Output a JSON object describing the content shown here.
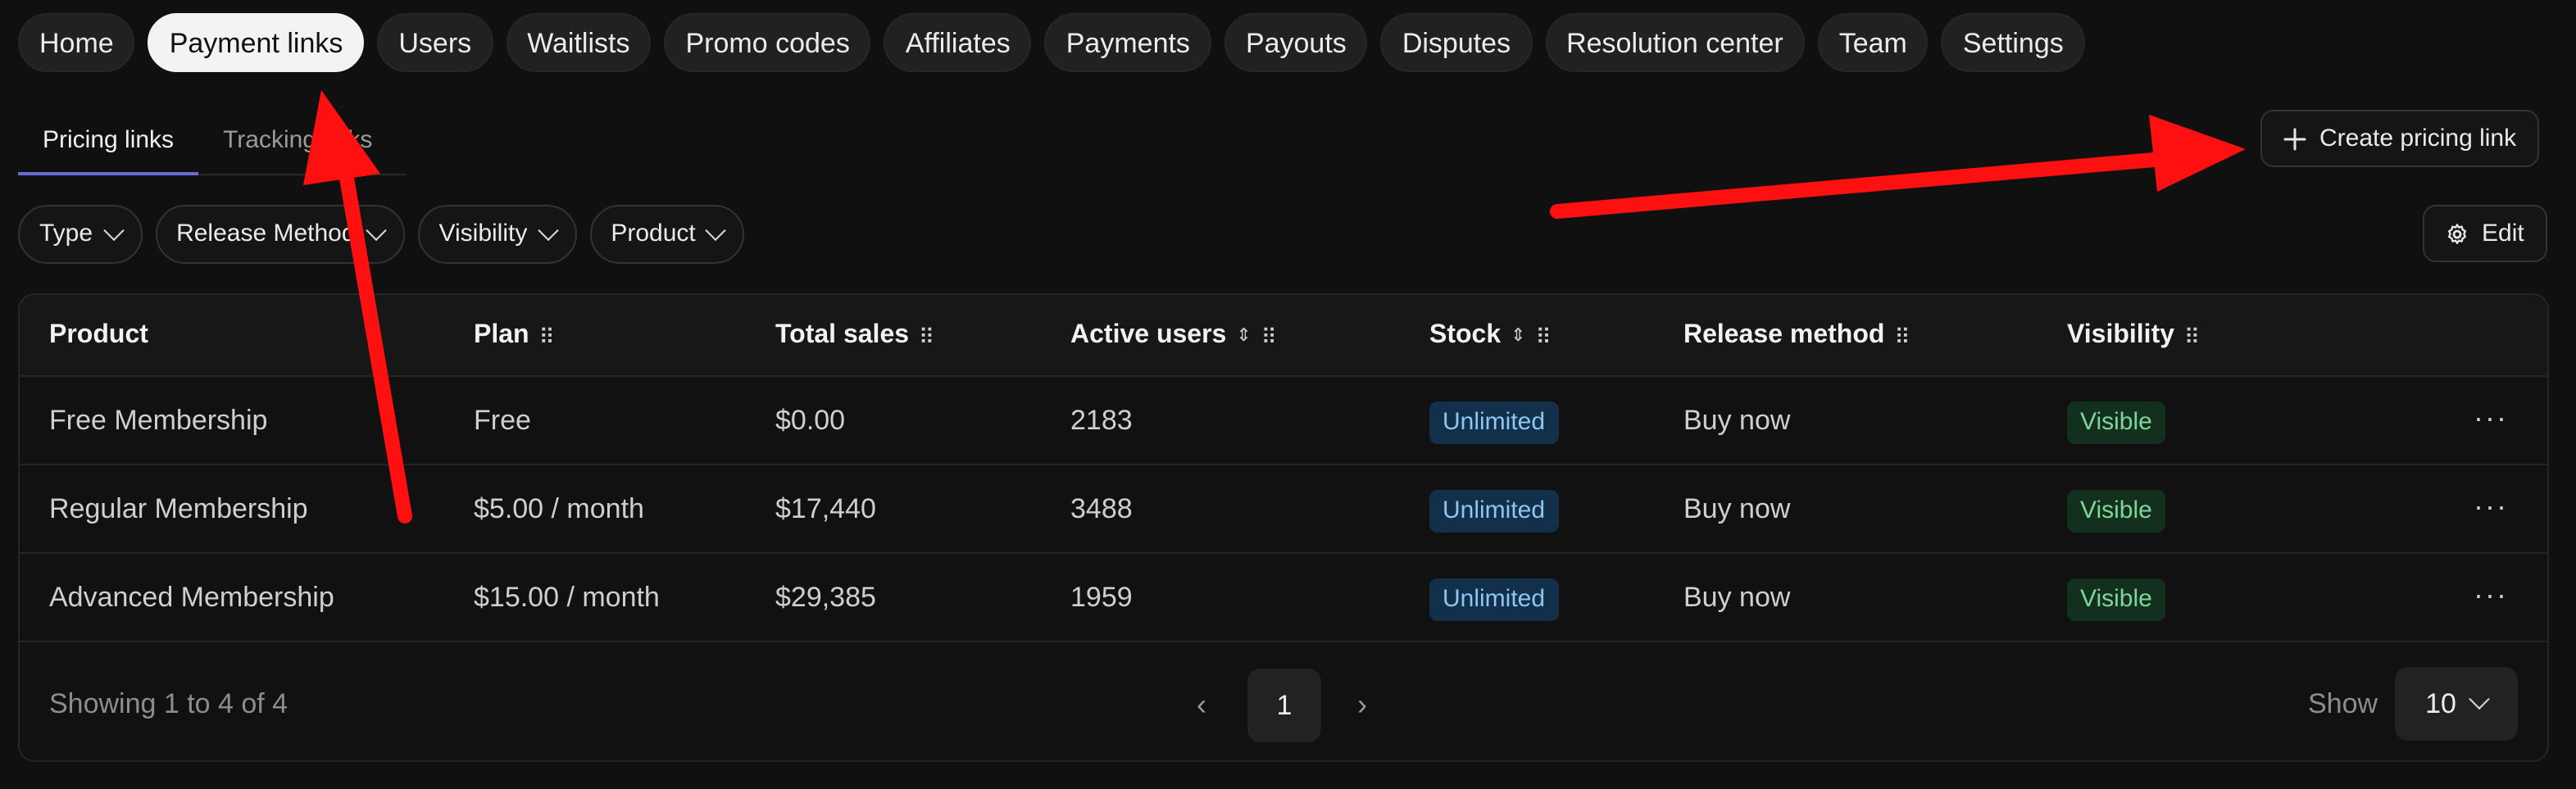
{
  "topnav": {
    "items": [
      {
        "label": "Home",
        "active": false
      },
      {
        "label": "Payment links",
        "active": true
      },
      {
        "label": "Users",
        "active": false
      },
      {
        "label": "Waitlists",
        "active": false
      },
      {
        "label": "Promo codes",
        "active": false
      },
      {
        "label": "Affiliates",
        "active": false
      },
      {
        "label": "Payments",
        "active": false
      },
      {
        "label": "Payouts",
        "active": false
      },
      {
        "label": "Disputes",
        "active": false
      },
      {
        "label": "Resolution center",
        "active": false
      },
      {
        "label": "Team",
        "active": false
      },
      {
        "label": "Settings",
        "active": false
      }
    ]
  },
  "subtabs": {
    "pricing": "Pricing links",
    "tracking": "Tracking links"
  },
  "actions": {
    "create": "Create pricing link",
    "edit": "Edit"
  },
  "filters": {
    "type": "Type",
    "release_method": "Release Method",
    "visibility": "Visibility",
    "product": "Product"
  },
  "table": {
    "headers": {
      "product": "Product",
      "plan": "Plan",
      "total_sales": "Total sales",
      "active_users": "Active users",
      "stock": "Stock",
      "release_method": "Release method",
      "visibility": "Visibility"
    },
    "rows": [
      {
        "product": "Free Membership",
        "plan": "Free",
        "total_sales": "$0.00",
        "active_users": "2183",
        "stock": "Unlimited",
        "release_method": "Buy now",
        "visibility": "Visible"
      },
      {
        "product": "Regular Membership",
        "plan": "$5.00 / month",
        "total_sales": "$17,440",
        "active_users": "3488",
        "stock": "Unlimited",
        "release_method": "Buy now",
        "visibility": "Visible"
      },
      {
        "product": "Advanced Membership",
        "plan": "$15.00 / month",
        "total_sales": "$29,385",
        "active_users": "1959",
        "stock": "Unlimited",
        "release_method": "Buy now",
        "visibility": "Visible"
      }
    ]
  },
  "footer": {
    "showing": "Showing 1 to 4 of 4",
    "current_page": "1",
    "show_label": "Show",
    "page_size": "10"
  },
  "colors": {
    "annotation_arrow": "#ff1010",
    "active_tab_underline": "#6b6bd6"
  }
}
